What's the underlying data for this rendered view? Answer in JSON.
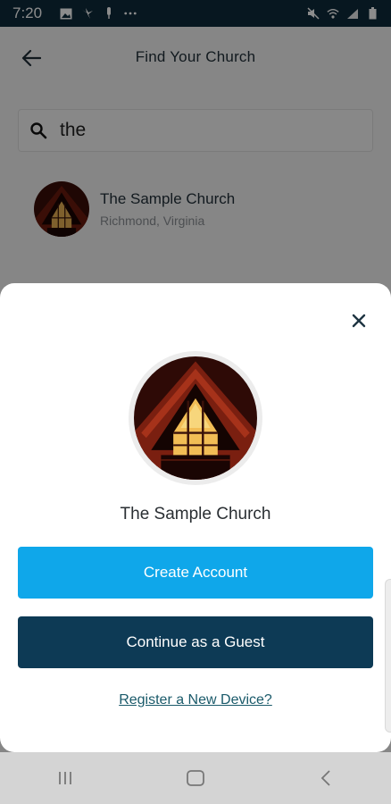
{
  "status_bar": {
    "time": "7:20",
    "left_icons": [
      "image-icon",
      "fan-icon",
      "microphone-icon",
      "more-icon"
    ],
    "right_icons": [
      "mute-icon",
      "wifi-icon",
      "signal-icon",
      "battery-icon"
    ]
  },
  "header": {
    "title": "Find Your Church",
    "back_icon": "arrow-left-icon"
  },
  "search": {
    "value": "the",
    "icon": "search-icon"
  },
  "results": [
    {
      "name": "The Sample Church",
      "location": "Richmond, Virginia"
    }
  ],
  "sheet": {
    "church_name": "The Sample Church",
    "create_account_label": "Create Account",
    "guest_label": "Continue as a Guest",
    "register_link": "Register a New Device?",
    "close_icon": "close-icon"
  },
  "colors": {
    "status_bar": "#0d2a3b",
    "create_account": "#0fa7ea",
    "guest": "#0d3a55",
    "link": "#1a5a6a"
  }
}
